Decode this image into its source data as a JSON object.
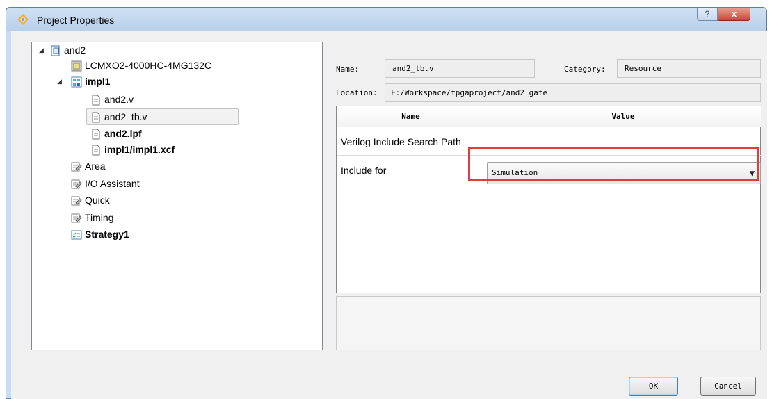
{
  "window": {
    "title": "Project Properties",
    "help_glyph": "?",
    "close_glyph": "x"
  },
  "tree": {
    "root": "and2",
    "device": "LCMXO2-4000HC-4MG132C",
    "impl": "impl1",
    "files": [
      "and2.v",
      "and2_tb.v",
      "and2.lpf",
      "impl1/impl1.xcf"
    ],
    "strategies": [
      "Area",
      "I/O Assistant",
      "Quick",
      "Timing",
      "Strategy1"
    ]
  },
  "details": {
    "name_label": "Name:",
    "name_value": "and2_tb.v",
    "category_label": "Category:",
    "category_value": "Resource",
    "location_label": "Location:",
    "location_value": "F:/Workspace/fpgaproject/and2_gate"
  },
  "grid": {
    "col_name": "Name",
    "col_value": "Value",
    "rows": [
      {
        "name": "Verilog Include Search Path",
        "value": ""
      },
      {
        "name": "Include for",
        "value": "Simulation"
      }
    ]
  },
  "buttons": {
    "ok": "OK",
    "cancel": "Cancel"
  },
  "colors": {
    "highlight_box": "#e03c3c",
    "title_bar": "#c9dcf1"
  }
}
